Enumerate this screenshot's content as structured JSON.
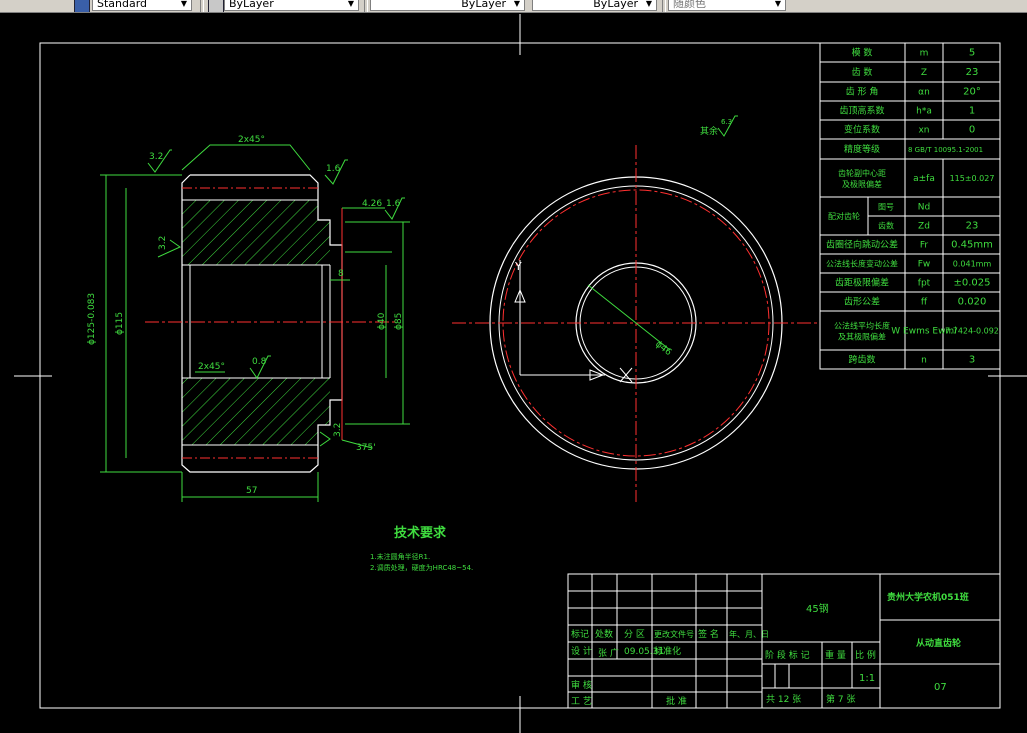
{
  "toolbar": {
    "text_style": "Standard",
    "layer": "ByLayer",
    "linetype": "ByLayer",
    "lineweight": "ByLayer",
    "color": "随颜色"
  },
  "dimensions": {
    "chamfer_top": "2x45°",
    "chamfer_bottom": "2x45°",
    "rough_32_top": "3.2",
    "rough_16_top": "1.6",
    "rough_16_right": "1.6",
    "rough_32_left": "3.2",
    "rough_08": "0.8",
    "rough_32_bottom": "3.2",
    "dim_426": "4.26",
    "dim_8": "8",
    "dim_phi125": "ϕ125-0.083",
    "dim_phi115": "ϕ115",
    "dim_phi40": "ϕ40",
    "dim_phi85": "ϕ85",
    "dim_57": "57",
    "dim_375": "375'",
    "dim_phi46": "ϕ46",
    "other_rough": "其余",
    "other_rough_val": "6.3",
    "axis_y": "Y"
  },
  "param_table": {
    "rows": [
      {
        "name": "模    数",
        "sym": "m",
        "val": "5"
      },
      {
        "name": "齿    数",
        "sym": "Z",
        "val": "23"
      },
      {
        "name": "齿  形  角",
        "sym": "αn",
        "val": "20°"
      },
      {
        "name": "齿顶高系数",
        "sym": "h*a",
        "val": "1"
      },
      {
        "name": "变位系数",
        "sym": "xn",
        "val": "0"
      },
      {
        "name": "精度等级",
        "sym": "",
        "val": "8 GB/T 10095.1-2001"
      },
      {
        "name": "齿轮副中心距及极限偏差",
        "sym": "a±fa",
        "val": "115±0.027"
      },
      {
        "name": "图号",
        "sym": "Nd",
        "val": ""
      },
      {
        "name": "齿数",
        "sym": "Zd",
        "val": "23"
      },
      {
        "name": "齿圈径向跳动公差",
        "sym": "Fr",
        "val": "0.45mm"
      },
      {
        "name": "公法线长度变动公差",
        "sym": "Fw",
        "val": "0.041mm"
      },
      {
        "name": "齿距极限偏差",
        "sym": "fpt",
        "val": "±0.025"
      },
      {
        "name": "齿形公差",
        "sym": "ff",
        "val": "0.020"
      },
      {
        "name": "公法线平均长度及其极限偏差",
        "sym": "W Ewms Ewmi",
        "val": "7.7424-0.092"
      },
      {
        "name": "跨齿数",
        "sym": "n",
        "val": "3"
      }
    ],
    "group_label": "配对齿轮"
  },
  "tech": {
    "title": "技术要求",
    "line1": "1.未注圆角半径R1.",
    "line2": "2.调质处理，硬度为HRC48~54."
  },
  "title_block": {
    "material": "45钢",
    "school": "贵州大学农机051班",
    "part_name": "从动直齿轮",
    "drawing_no": "07",
    "h_mark": "标记",
    "h_count": "处数",
    "h_zone": "分 区",
    "h_doc": "更改文件号",
    "h_sign": "签 名",
    "h_date": "年、月、日",
    "design": "设 计",
    "designer": "张  广",
    "design_date": "09.05.31",
    "standardize": "标准化",
    "stage": "阶 段 标 记",
    "weight": "重 量",
    "scale_label": "比 例",
    "scale": "1:1",
    "review": "审 核",
    "process": "工 艺",
    "approve": "批 准",
    "total_sheets": "共 12 张",
    "sheet_no": "第 7 张"
  }
}
